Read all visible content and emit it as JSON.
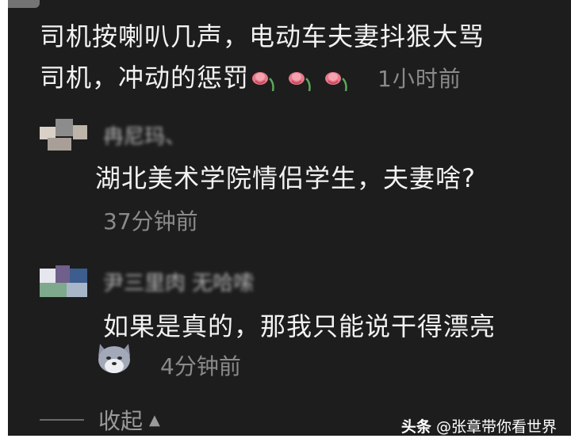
{
  "comment": {
    "line1": "司机按喇叭几声，电动车夫妻抖狠大骂",
    "line2": "司机，冲动的惩罚",
    "time": "1小时前",
    "emoji_count": 3,
    "emoji_icon": "wilted-rose-icon"
  },
  "replies": [
    {
      "username": "冉尼玛、",
      "text": "湖北美术学院情侣学生，夫妻啥?",
      "time": "37分钟前"
    },
    {
      "username": "尹三里肉 无哈嗦",
      "text": "如果是真的，那我只能说干得漂亮",
      "time": "4分钟前",
      "sticker_icon": "wolf-face-icon"
    }
  ],
  "collapse_label": "收起",
  "watermark": {
    "brand": "头条",
    "handle": "@张章带你看世界"
  },
  "colors": {
    "background": "#1d1d1d",
    "text": "#f2f2f2",
    "muted": "#8a8a8a"
  }
}
